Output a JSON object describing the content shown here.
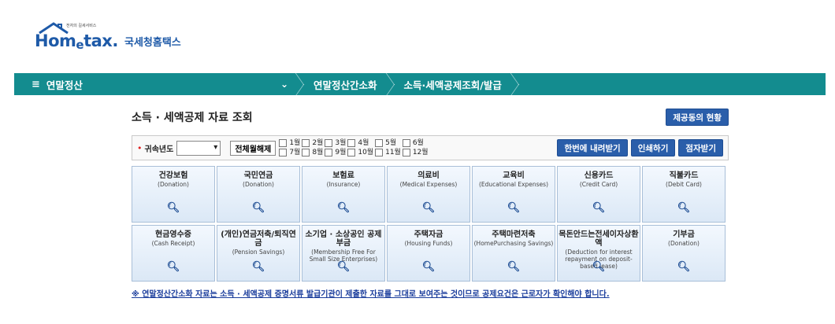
{
  "header": {
    "logo_tiny": "전자의 길세서비스",
    "logo_word_a": "Hom",
    "logo_word_e": "e",
    "logo_word_b": "tax.",
    "logo_kr": "국세청홈택스"
  },
  "nav": {
    "menu_icon": "≡",
    "menu_label": "연말정산",
    "dropdown_icon": "chevron-down-icon",
    "crumb1": "연말정산간소화",
    "crumb2": "소득·세액공제조회/발급"
  },
  "page": {
    "title": "소득 · 세액공제 자료 조회",
    "status_button": "제공동의 현황"
  },
  "filter": {
    "year_label": "귀속년도",
    "year_value": "",
    "select_all": "전체월해제",
    "months": [
      "1월",
      "2월",
      "3월",
      "4월",
      "5월",
      "6월",
      "7월",
      "8월",
      "9월",
      "10월",
      "11월",
      "12월"
    ],
    "download_button": "한번에 내려받기",
    "print_button": "인쇄하기",
    "braille_button": "점자받기"
  },
  "tiles": [
    {
      "name": "건강보험",
      "en": "(Donation)"
    },
    {
      "name": "국민연금",
      "en": "(Donation)"
    },
    {
      "name": "보험료",
      "en": "(Insurance)"
    },
    {
      "name": "의료비",
      "en": "(Medical Expenses)"
    },
    {
      "name": "교육비",
      "en": "(Educational Expenses)"
    },
    {
      "name": "신용카드",
      "en": "(Credit Card)"
    },
    {
      "name": "직불카드",
      "en": "(Debit Card)"
    },
    {
      "name": "현금영수증",
      "en": "(Cash Receipt)"
    },
    {
      "name": "(개인)연금저축/퇴직연금",
      "en": "(Pension Savings)"
    },
    {
      "name": "소기업 · 소상공인 공제부금",
      "en": "(Membership Free For Small Size Enterprises)"
    },
    {
      "name": "주택자금",
      "en": "(Housing Funds)"
    },
    {
      "name": "주택마련저축",
      "en": "(HomePurchasing Savings)"
    },
    {
      "name": "목돈안드는전세이자상환액",
      "en": "(Deduction for interest repayment on deposit-based lease)"
    },
    {
      "name": "기부금",
      "en": "(Donation)"
    }
  ],
  "notice": "※ 연말정산간소화 자료는 소득 · 세액공제 증명서류 발급기관이 제출한 자료를 그대로 보여주는 것이므로 공제요건은 근로자가 확인해야 합니다.",
  "colors": {
    "nav_bg": "#138c8f",
    "button_blue": "#2a5eaa",
    "tile_border": "#a9bfd8",
    "notice": "#1a3d9c"
  }
}
